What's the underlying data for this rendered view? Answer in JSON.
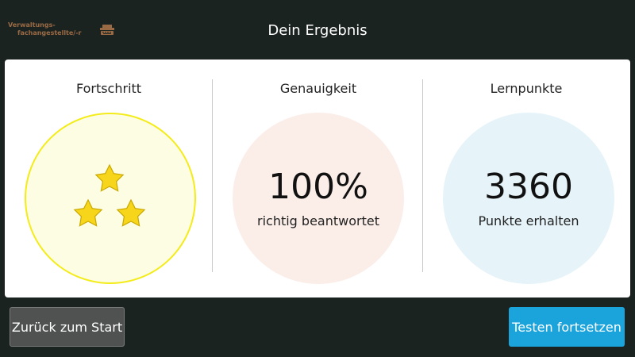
{
  "header": {
    "logo_line1": "Verwaltungs-",
    "logo_line2": "fachangestellte/-r",
    "logo_icon": "typewriter-icon",
    "title": "Dein Ergebnis"
  },
  "results": {
    "progress": {
      "title": "Fortschritt",
      "stars_filled": 3,
      "stars_total": 3
    },
    "accuracy": {
      "title": "Genauigkeit",
      "value": "100%",
      "caption": "richtig beantwortet"
    },
    "points": {
      "title": "Lernpunkte",
      "value": "3360",
      "caption": "Punkte erhalten"
    }
  },
  "buttons": {
    "back_label": "Zurück zum Start",
    "continue_label": "Testen fortsetzen"
  },
  "colors": {
    "background": "#1b2321",
    "star": "#f6d51a",
    "progress_ring": "#f4ec1a",
    "accent_button": "#1ba4dc"
  }
}
